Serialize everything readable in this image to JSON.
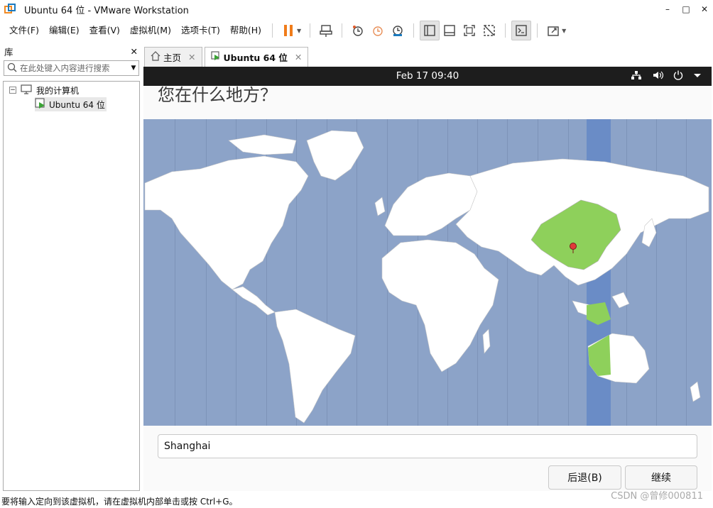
{
  "window": {
    "title": "Ubuntu 64 位 - VMware Workstation",
    "minimize": "–",
    "maximize": "□",
    "close": "✕"
  },
  "menu": {
    "items": [
      "文件(F)",
      "编辑(E)",
      "查看(V)",
      "虚拟机(M)",
      "选项卡(T)",
      "帮助(H)"
    ]
  },
  "library": {
    "title": "库",
    "close": "✕",
    "search_placeholder": "在此处键入内容进行搜索",
    "tree": {
      "root": "我的计算机",
      "child": "Ubuntu 64 位"
    }
  },
  "tabs": [
    {
      "label": "主页"
    },
    {
      "label": "Ubuntu 64 位"
    }
  ],
  "guest": {
    "clock": "Feb 17  09:40",
    "heading": "您在什么地方？",
    "location_value": "Shanghai",
    "back_label": "后退(B)",
    "continue_label": "继续"
  },
  "status": {
    "text": "要将输入定向到该虚拟机，请在虚拟机内部单击或按 Ctrl+G。",
    "watermark": "CSDN @曾修000811"
  },
  "colors": {
    "ocean": "#8ca3c8",
    "land": "#ffffff",
    "highlight_land": "#8ed05b",
    "timezone_band": "#6a8cc6"
  }
}
